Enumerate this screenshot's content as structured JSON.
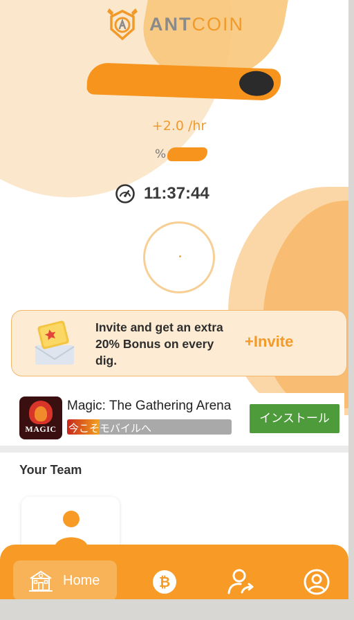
{
  "brand": {
    "ant": "ANT",
    "coin": "COIN"
  },
  "mining": {
    "rate": "+2.0 /hr",
    "percent_sign": "%",
    "timer": "11:37:44"
  },
  "invite": {
    "text": "Invite and get an extra 20% Bonus on every dig.",
    "button": "+Invite"
  },
  "ad": {
    "title": "Magic: The Gathering Arena",
    "subtitle": "今こそモバイルへ",
    "icon_brand": "MAGIC",
    "install": "インストール"
  },
  "team": {
    "title": "Your Team"
  },
  "nav": {
    "home": "Home",
    "icons": [
      "home-icon",
      "bitcoin-icon",
      "refer-user-icon",
      "profile-icon"
    ]
  },
  "colors": {
    "accent": "#f79a26",
    "install_green": "#4e9b3b",
    "logo_grey": "#8a8a8a"
  }
}
